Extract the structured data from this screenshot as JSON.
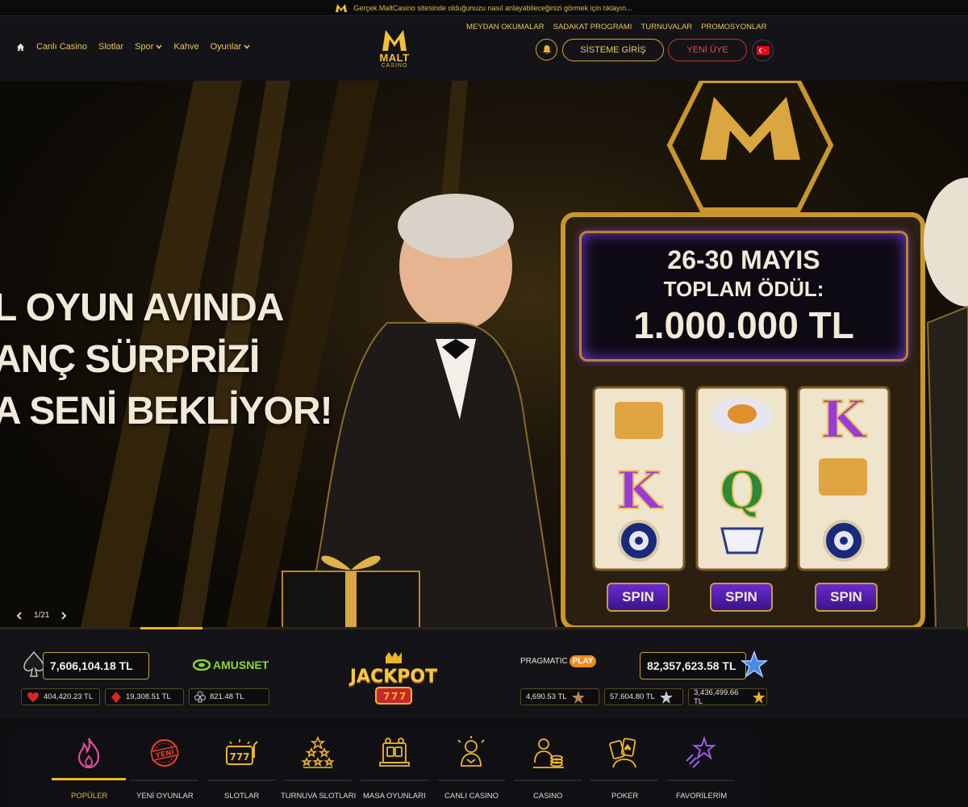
{
  "notice": {
    "text": "Gerçek MaltCasino sitesinde olduğunuzu nasıl anlayabileceğinizi görmek için tıklayın..."
  },
  "nav": {
    "items": [
      {
        "label": "Canlı Casino"
      },
      {
        "label": "Slotlar"
      },
      {
        "label": "Spor"
      },
      {
        "label": "Kahve"
      },
      {
        "label": "Oyunlar"
      }
    ]
  },
  "logo": {
    "word": "MALT",
    "sub": "CASINO"
  },
  "top_links": [
    "MEYDAN OKUMALAR",
    "SADAKAT PROGRAMI",
    "TURNUVALAR",
    "PROMOSYONLAR"
  ],
  "auth": {
    "login": "SİSTEME GİRİŞ",
    "register": "YENİ ÜYE"
  },
  "colors": {
    "accent": "#e8b42a",
    "register": "#e84a3a",
    "background": "#141418"
  },
  "hero": {
    "lines": [
      "L OYUN AVINDA",
      "ANÇ SÜRPRİZİ",
      "A SENİ BEKLİYOR!"
    ],
    "screen": {
      "date": "26-30 MAYIS",
      "label": "TOPLAM ÖDÜL:",
      "amount": "1.000.000 TL"
    },
    "spin": "SPIN",
    "pager": "1/21",
    "slide_progress": 0.0476
  },
  "jackpot": {
    "amusnet_main": "7,606,104.18 TL",
    "amusnet_small": [
      "404,420.23 TL",
      "19,308.51 TL",
      "821.48 TL"
    ],
    "amusnet_brand": "AMUSNET",
    "logo_text": "JACKPOT",
    "pragmatic_brand": "PRAGMATIC",
    "pragmatic_play": "PLAY",
    "pragmatic_main": "82,357,623.58 TL",
    "pragmatic_small": [
      "4,690.53 TL",
      "57,604.80 TL",
      "3,436,499.66 TL"
    ]
  },
  "categories": [
    {
      "label": "POPÜLER",
      "icon": "fire-icon",
      "active": true
    },
    {
      "label": "YENİ OYUNLAR",
      "icon": "new-stamp-icon"
    },
    {
      "label": "SLOTLAR",
      "icon": "slot-777-icon"
    },
    {
      "label": "TURNUVA SLOTLARI",
      "icon": "stars-pyramid-icon"
    },
    {
      "label": "MASA OYUNLARI",
      "icon": "table-games-icon"
    },
    {
      "label": "CANLI CASINO",
      "icon": "live-dealer-icon"
    },
    {
      "label": "CASINO",
      "icon": "casino-chips-icon"
    },
    {
      "label": "POKER",
      "icon": "cards-icon"
    },
    {
      "label": "FAVORİLERİM",
      "icon": "favorite-star-icon"
    }
  ]
}
